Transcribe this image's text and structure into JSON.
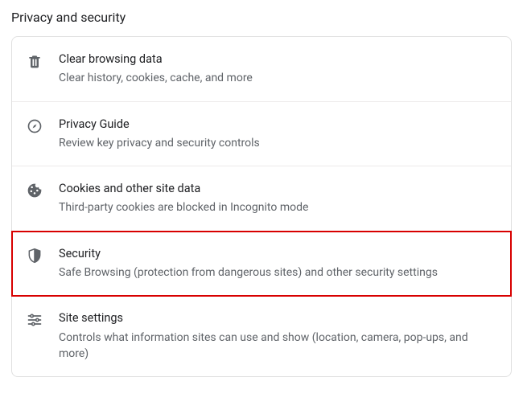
{
  "page_title": "Privacy and security",
  "items": [
    {
      "title": "Clear browsing data",
      "desc": "Clear history, cookies, cache, and more"
    },
    {
      "title": "Privacy Guide",
      "desc": "Review key privacy and security controls"
    },
    {
      "title": "Cookies and other site data",
      "desc": "Third-party cookies are blocked in Incognito mode"
    },
    {
      "title": "Security",
      "desc": "Safe Browsing (protection from dangerous sites) and other security settings"
    },
    {
      "title": "Site settings",
      "desc": "Controls what information sites can use and show (location, camera, pop-ups, and more)"
    }
  ]
}
